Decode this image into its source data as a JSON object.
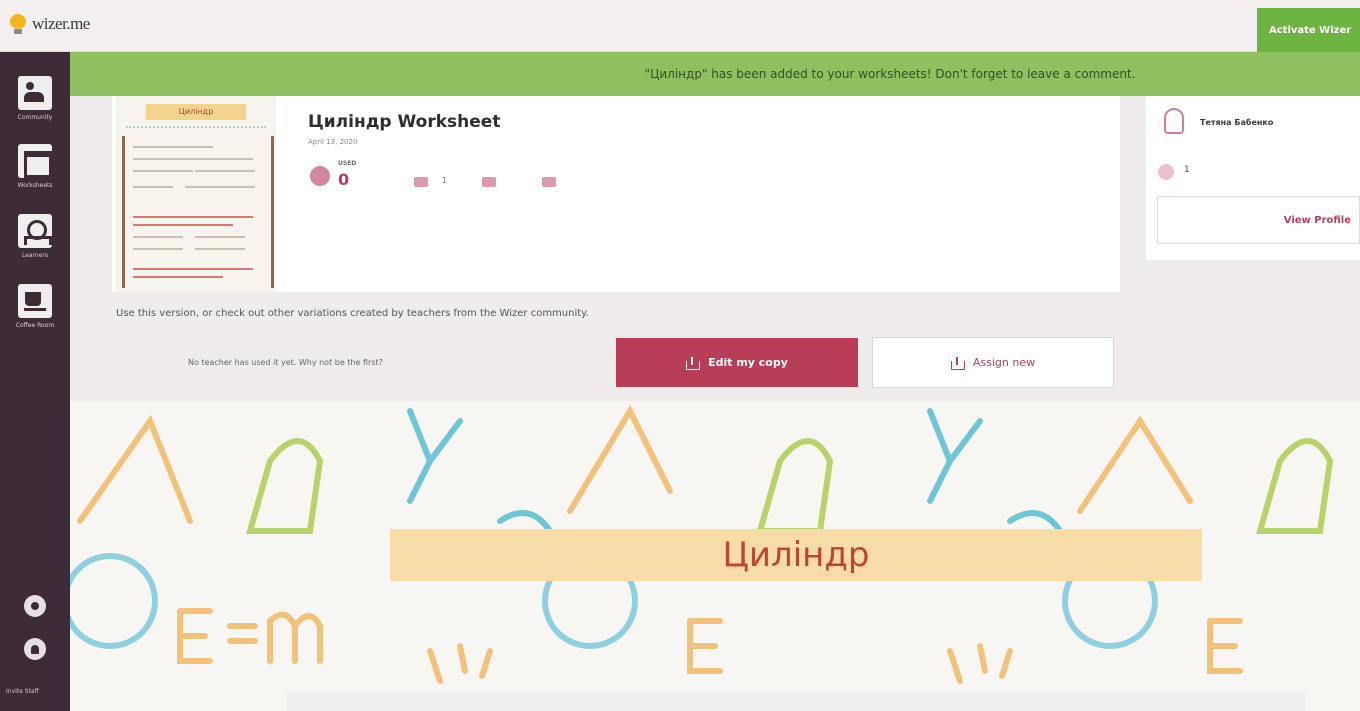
{
  "topbar": {
    "logo_text": "wizer.me",
    "activate_label": "Activate Wizer"
  },
  "sidebar": {
    "items": [
      {
        "label": "Community",
        "icon": "community-icon"
      },
      {
        "label": "Worksheets",
        "icon": "worksheets-icon"
      },
      {
        "label": "Learners",
        "icon": "learners-icon"
      },
      {
        "label": "Coffee Room",
        "icon": "coffee-icon"
      }
    ],
    "footer": "Invite Staff"
  },
  "notification": "\"Циліндр\" has been added to your worksheets! Don't forget to leave a comment.",
  "worksheet": {
    "title": "Циліндр Worksheet",
    "date": "April 13, 2020",
    "thumbnail_title": "Циліндр",
    "stat_label": "USED",
    "stat_value": "0",
    "count": "1"
  },
  "author": {
    "name": "Тетяна Бабенко",
    "stat": "1",
    "view_profile": "View Profile"
  },
  "actions": {
    "variations_text": "Use this version, or check out other variations created by teachers from the Wizer community.",
    "no_teacher_text": "No teacher has used it yet. Why not be the first?",
    "edit_label": "Edit my copy",
    "assign_label": "Assign new"
  },
  "preview": {
    "title": "Циліндр"
  },
  "colors": {
    "sidebar": "#3d2b38",
    "notify": "#8fbf5f",
    "primary": "#b83e58"
  }
}
